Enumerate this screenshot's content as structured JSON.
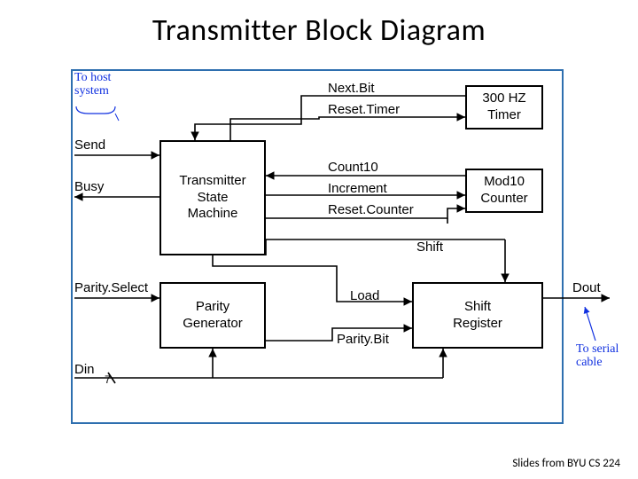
{
  "title": "Transmitter Block Diagram",
  "annotations": {
    "to_host": "To host\nsystem",
    "to_serial": "To serial\ncable"
  },
  "io": {
    "send": "Send",
    "busy": "Busy",
    "parity_select": "Parity.Select",
    "din": "Din",
    "din_width": "7",
    "dout": "Dout"
  },
  "blocks": {
    "sm": "Transmitter\nState\nMachine",
    "timer": "300 HZ\nTimer",
    "counter": "Mod10\nCounter",
    "parity": "Parity\nGenerator",
    "shiftreg": "Shift\nRegister"
  },
  "signals": {
    "next_bit": "Next.Bit",
    "reset_timer": "Reset.Timer",
    "count10": "Count10",
    "increment": "Increment",
    "reset_counter": "Reset.Counter",
    "shift": "Shift",
    "load": "Load",
    "parity_bit": "Parity.Bit"
  },
  "attrib": "Slides from BYU CS 224"
}
